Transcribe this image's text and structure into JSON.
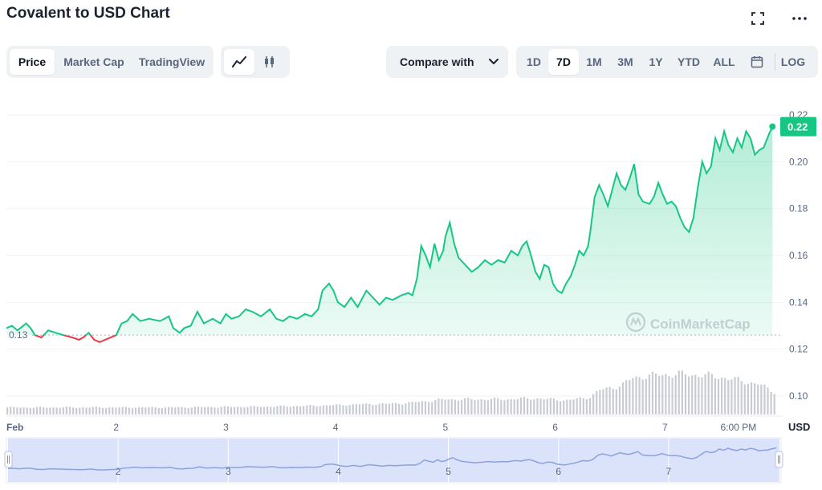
{
  "header": {
    "title": "Covalent to USD Chart"
  },
  "chart_tabs": [
    {
      "label": "Price",
      "active": true
    },
    {
      "label": "Market Cap",
      "active": false
    },
    {
      "label": "TradingView",
      "active": false
    }
  ],
  "chart_type_buttons": [
    {
      "icon": "line-chart-icon",
      "active": true
    },
    {
      "icon": "candlestick-icon",
      "active": false
    }
  ],
  "compare": {
    "label": "Compare with"
  },
  "ranges": [
    {
      "label": "1D",
      "active": false
    },
    {
      "label": "7D",
      "active": true
    },
    {
      "label": "1M",
      "active": false
    },
    {
      "label": "3M",
      "active": false
    },
    {
      "label": "1Y",
      "active": false
    },
    {
      "label": "YTD",
      "active": false
    },
    {
      "label": "ALL",
      "active": false
    }
  ],
  "log_label": "LOG",
  "icons": {
    "fullscreen": "fullscreen-icon",
    "more": "more-icon",
    "calendar": "calendar-icon"
  },
  "colors": {
    "up": "#16c784",
    "down": "#ea3943",
    "volume": "#c8ccd2",
    "navigator_fill": "#dbe3fb",
    "navigator_line": "#8da1dd"
  },
  "chart_data": {
    "type": "line",
    "title": "Covalent to USD Chart",
    "currency_label": "USD",
    "y_ticks": [
      "0.22",
      "0.20",
      "0.18",
      "0.16",
      "0.14",
      "0.12",
      "0.10"
    ],
    "ylim": [
      0.1,
      0.22
    ],
    "baseline": {
      "value": 0.126,
      "label": "0.13"
    },
    "current_price": {
      "value": 0.215,
      "label": "0.22"
    },
    "x_ticks": [
      {
        "t": 0,
        "label": "Feb"
      },
      {
        "t": 1,
        "label": "2"
      },
      {
        "t": 2,
        "label": "3"
      },
      {
        "t": 3,
        "label": "4"
      },
      {
        "t": 4,
        "label": "5"
      },
      {
        "t": 5,
        "label": "6"
      },
      {
        "t": 6,
        "label": "7"
      },
      {
        "t": 6.67,
        "label": "6:00 PM"
      }
    ],
    "navigator_ticks": [
      {
        "t": 1,
        "label": "2"
      },
      {
        "t": 2,
        "label": "3"
      },
      {
        "t": 3,
        "label": "4"
      },
      {
        "t": 4,
        "label": "5"
      },
      {
        "t": 5,
        "label": "6"
      },
      {
        "t": 6,
        "label": "7"
      }
    ],
    "price_series": [
      [
        0.0,
        0.129
      ],
      [
        0.05,
        0.13
      ],
      [
        0.1,
        0.128
      ],
      [
        0.18,
        0.131
      ],
      [
        0.22,
        0.129
      ],
      [
        0.26,
        0.126
      ],
      [
        0.32,
        0.125
      ],
      [
        0.38,
        0.128
      ],
      [
        0.45,
        0.127
      ],
      [
        0.52,
        0.126
      ],
      [
        0.6,
        0.125
      ],
      [
        0.66,
        0.124
      ],
      [
        0.7,
        0.125
      ],
      [
        0.75,
        0.127
      ],
      [
        0.8,
        0.124
      ],
      [
        0.85,
        0.123
      ],
      [
        0.9,
        0.124
      ],
      [
        0.95,
        0.125
      ],
      [
        1.0,
        0.126
      ],
      [
        1.05,
        0.131
      ],
      [
        1.1,
        0.132
      ],
      [
        1.15,
        0.135
      ],
      [
        1.22,
        0.132
      ],
      [
        1.3,
        0.133
      ],
      [
        1.4,
        0.132
      ],
      [
        1.48,
        0.134
      ],
      [
        1.52,
        0.129
      ],
      [
        1.58,
        0.127
      ],
      [
        1.62,
        0.129
      ],
      [
        1.68,
        0.13
      ],
      [
        1.74,
        0.136
      ],
      [
        1.8,
        0.131
      ],
      [
        1.88,
        0.133
      ],
      [
        1.95,
        0.131
      ],
      [
        2.0,
        0.135
      ],
      [
        2.05,
        0.133
      ],
      [
        2.12,
        0.134
      ],
      [
        2.18,
        0.137
      ],
      [
        2.24,
        0.136
      ],
      [
        2.32,
        0.134
      ],
      [
        2.4,
        0.137
      ],
      [
        2.46,
        0.133
      ],
      [
        2.52,
        0.132
      ],
      [
        2.58,
        0.134
      ],
      [
        2.65,
        0.133
      ],
      [
        2.72,
        0.135
      ],
      [
        2.78,
        0.134
      ],
      [
        2.84,
        0.137
      ],
      [
        2.88,
        0.145
      ],
      [
        2.94,
        0.148
      ],
      [
        2.98,
        0.145
      ],
      [
        3.02,
        0.14
      ],
      [
        3.08,
        0.138
      ],
      [
        3.14,
        0.142
      ],
      [
        3.2,
        0.138
      ],
      [
        3.28,
        0.145
      ],
      [
        3.34,
        0.142
      ],
      [
        3.4,
        0.139
      ],
      [
        3.46,
        0.142
      ],
      [
        3.52,
        0.141
      ],
      [
        3.6,
        0.143
      ],
      [
        3.66,
        0.144
      ],
      [
        3.7,
        0.143
      ],
      [
        3.74,
        0.15
      ],
      [
        3.78,
        0.164
      ],
      [
        3.82,
        0.16
      ],
      [
        3.86,
        0.155
      ],
      [
        3.9,
        0.165
      ],
      [
        3.94,
        0.158
      ],
      [
        3.98,
        0.162
      ],
      [
        4.0,
        0.168
      ],
      [
        4.04,
        0.174
      ],
      [
        4.08,
        0.165
      ],
      [
        4.12,
        0.159
      ],
      [
        4.18,
        0.156
      ],
      [
        4.24,
        0.153
      ],
      [
        4.3,
        0.155
      ],
      [
        4.36,
        0.158
      ],
      [
        4.42,
        0.156
      ],
      [
        4.48,
        0.158
      ],
      [
        4.54,
        0.157
      ],
      [
        4.6,
        0.162
      ],
      [
        4.66,
        0.16
      ],
      [
        4.7,
        0.164
      ],
      [
        4.74,
        0.166
      ],
      [
        4.78,
        0.16
      ],
      [
        4.82,
        0.153
      ],
      [
        4.86,
        0.15
      ],
      [
        4.9,
        0.156
      ],
      [
        4.94,
        0.155
      ],
      [
        4.98,
        0.148
      ],
      [
        5.02,
        0.145
      ],
      [
        5.06,
        0.144
      ],
      [
        5.1,
        0.148
      ],
      [
        5.14,
        0.151
      ],
      [
        5.18,
        0.156
      ],
      [
        5.22,
        0.162
      ],
      [
        5.26,
        0.16
      ],
      [
        5.3,
        0.164
      ],
      [
        5.32,
        0.17
      ],
      [
        5.36,
        0.185
      ],
      [
        5.4,
        0.19
      ],
      [
        5.44,
        0.186
      ],
      [
        5.48,
        0.181
      ],
      [
        5.52,
        0.188
      ],
      [
        5.56,
        0.195
      ],
      [
        5.6,
        0.19
      ],
      [
        5.64,
        0.188
      ],
      [
        5.68,
        0.193
      ],
      [
        5.72,
        0.199
      ],
      [
        5.76,
        0.186
      ],
      [
        5.8,
        0.183
      ],
      [
        5.86,
        0.182
      ],
      [
        5.9,
        0.185
      ],
      [
        5.94,
        0.191
      ],
      [
        5.98,
        0.186
      ],
      [
        6.02,
        0.182
      ],
      [
        6.06,
        0.183
      ],
      [
        6.1,
        0.181
      ],
      [
        6.14,
        0.176
      ],
      [
        6.18,
        0.172
      ],
      [
        6.22,
        0.17
      ],
      [
        6.26,
        0.176
      ],
      [
        6.3,
        0.189
      ],
      [
        6.34,
        0.2
      ],
      [
        6.38,
        0.195
      ],
      [
        6.42,
        0.198
      ],
      [
        6.46,
        0.21
      ],
      [
        6.5,
        0.205
      ],
      [
        6.54,
        0.213
      ],
      [
        6.58,
        0.207
      ],
      [
        6.62,
        0.204
      ],
      [
        6.66,
        0.21
      ],
      [
        6.7,
        0.206
      ],
      [
        6.74,
        0.213
      ],
      [
        6.78,
        0.21
      ],
      [
        6.82,
        0.203
      ],
      [
        6.86,
        0.205
      ],
      [
        6.9,
        0.206
      ],
      [
        6.95,
        0.212
      ],
      [
        6.98,
        0.215
      ]
    ],
    "volume_series": [
      [
        0.0,
        0.14
      ],
      [
        0.5,
        0.14
      ],
      [
        1.0,
        0.14
      ],
      [
        1.5,
        0.14
      ],
      [
        2.0,
        0.15
      ],
      [
        2.5,
        0.16
      ],
      [
        2.9,
        0.18
      ],
      [
        3.2,
        0.2
      ],
      [
        3.6,
        0.22
      ],
      [
        3.8,
        0.26
      ],
      [
        4.0,
        0.3
      ],
      [
        4.5,
        0.3
      ],
      [
        4.8,
        0.32
      ],
      [
        5.1,
        0.28
      ],
      [
        5.3,
        0.34
      ],
      [
        5.4,
        0.48
      ],
      [
        5.6,
        0.58
      ],
      [
        5.7,
        0.72
      ],
      [
        5.8,
        0.76
      ],
      [
        6.1,
        0.8
      ],
      [
        6.3,
        0.78
      ],
      [
        6.5,
        0.74
      ],
      [
        6.7,
        0.66
      ],
      [
        6.85,
        0.6
      ],
      [
        6.98,
        0.45
      ]
    ],
    "xlim": [
      0,
      7
    ]
  }
}
